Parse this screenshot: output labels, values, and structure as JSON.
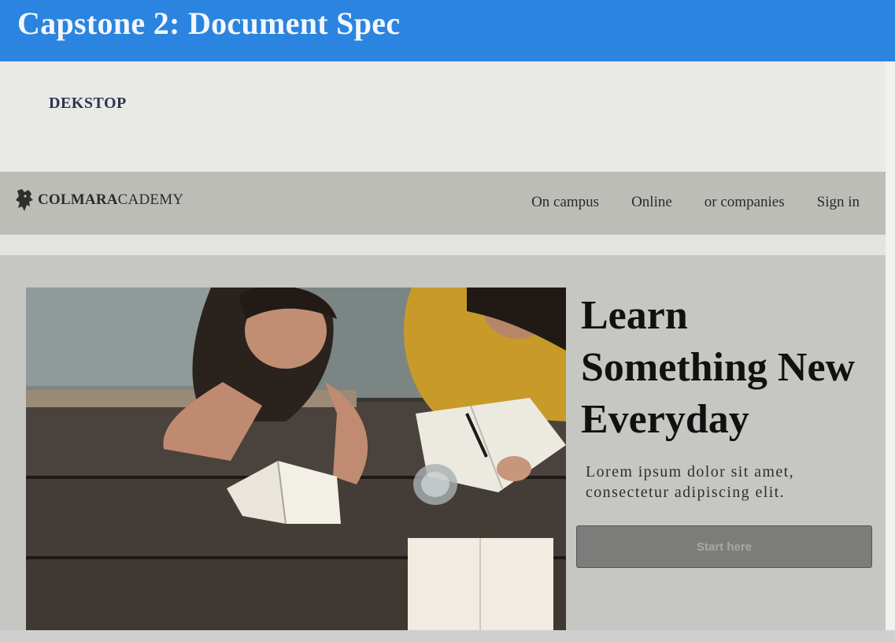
{
  "header": {
    "title": "Capstone 2: Document Spec"
  },
  "spec": {
    "label": "DEKSTOP"
  },
  "site": {
    "logo_bold": "COLMARA",
    "logo_rest": "CADEMY",
    "logo_icon": "griffin-crest-icon",
    "nav": [
      "On campus",
      "Online",
      "or companies",
      "Sign in"
    ]
  },
  "hero": {
    "image": "students-studying-at-picnic-table",
    "title_lines": [
      "Learn",
      "Something New",
      "Everyday"
    ],
    "subtitle": "Lorem ipsum dolor sit amet, consectetur adipiscing elit.",
    "button_label": "Start here"
  },
  "colors": {
    "header_bg": "#2a84e0",
    "navbar_bg": "#bdbdb8",
    "hero_bg": "#c6c6c2",
    "button_bg": "#7c7c7b"
  }
}
